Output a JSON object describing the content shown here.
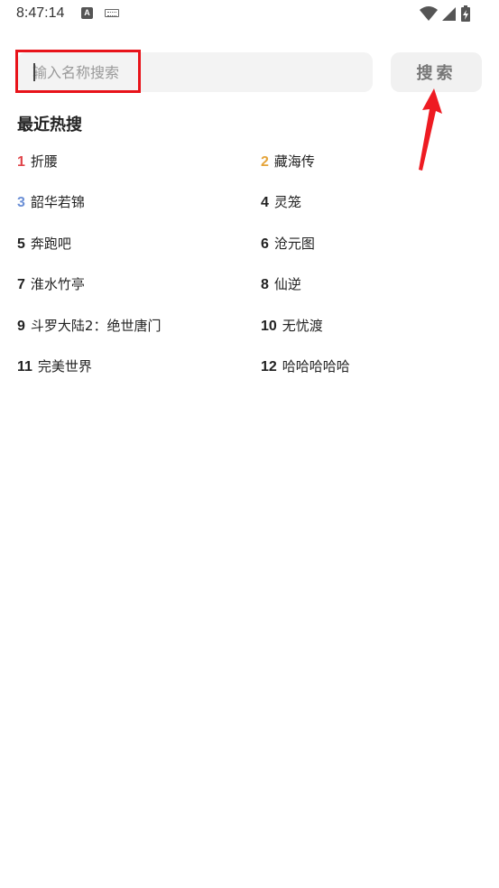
{
  "status_bar": {
    "time": "8:47:14",
    "a_icon_label": "A",
    "icons": [
      "wifi-icon",
      "signal-icon",
      "battery-charging-icon"
    ]
  },
  "search": {
    "placeholder": "输入名称搜索",
    "value": "",
    "button_label": "搜索"
  },
  "hot": {
    "title": "最近热搜",
    "rank_colors": {
      "1": "#e0454a",
      "2": "#e5a43a",
      "3": "#6b8fd6",
      "default": "#222222"
    },
    "items": [
      {
        "rank": "1",
        "name": "折腰"
      },
      {
        "rank": "2",
        "name": "藏海传"
      },
      {
        "rank": "3",
        "name": "韶华若锦"
      },
      {
        "rank": "4",
        "name": "灵笼"
      },
      {
        "rank": "5",
        "name": "奔跑吧"
      },
      {
        "rank": "6",
        "name": "沧元图"
      },
      {
        "rank": "7",
        "name": "淮水竹亭"
      },
      {
        "rank": "8",
        "name": "仙逆"
      },
      {
        "rank": "9",
        "name": "斗罗大陆2：绝世唐门"
      },
      {
        "rank": "10",
        "name": "无忧渡"
      },
      {
        "rank": "11",
        "name": "完美世界"
      },
      {
        "rank": "12",
        "name": "哈哈哈哈哈"
      }
    ]
  },
  "annotation_color": "#e8131a"
}
